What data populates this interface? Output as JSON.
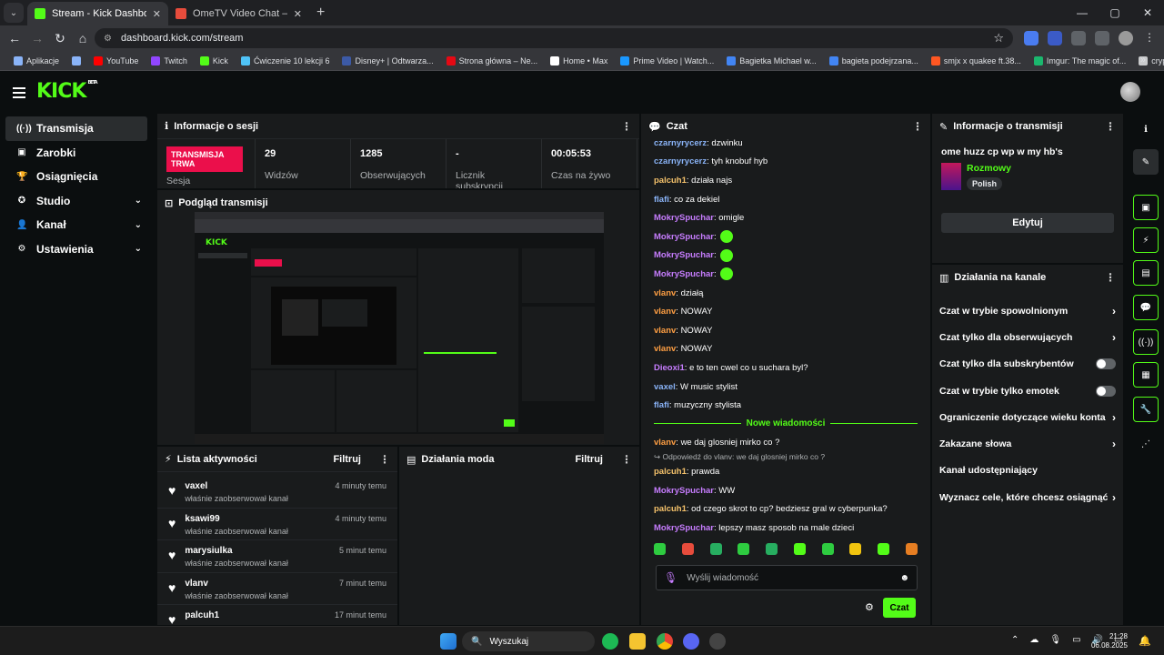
{
  "browser": {
    "tabs": [
      {
        "title": "Stream - Kick Dashboard",
        "color": "#53fc18",
        "active": true
      },
      {
        "title": "OmeTV Video Chat — Ome",
        "color": "#e74c3c",
        "active": false
      }
    ],
    "url": "dashboard.kick.com/stream",
    "bookmarks": [
      {
        "label": "Aplikacje",
        "color": "#8ab4f8"
      },
      {
        "label": "",
        "color": "#8ab4f8"
      },
      {
        "label": "YouTube",
        "color": "#ff0000"
      },
      {
        "label": "Twitch",
        "color": "#9146ff"
      },
      {
        "label": "Kick",
        "color": "#53fc18"
      },
      {
        "label": "Ćwiczenie 10 lekcji 6",
        "color": "#4fc3f7"
      },
      {
        "label": "Disney+ | Odtwarza...",
        "color": "#3c5aa6"
      },
      {
        "label": "Strona główna – Ne...",
        "color": "#e50914"
      },
      {
        "label": "Home • Max",
        "color": "#ffffff"
      },
      {
        "label": "Prime Video | Watch...",
        "color": "#1a98ff"
      },
      {
        "label": "Bagietka Michael w...",
        "color": "#4285f4"
      },
      {
        "label": "bagieta podejrzana...",
        "color": "#4285f4"
      },
      {
        "label": "smjx x quakee ft.38...",
        "color": "#ff5722"
      },
      {
        "label": "Imgur: The magic of...",
        "color": "#1bb76e"
      },
      {
        "label": "crypto",
        "color": "#c9cacc"
      }
    ],
    "bookmarks_more": "»"
  },
  "sidebar": {
    "items": [
      {
        "label": "Transmisja",
        "icon": "((·))",
        "chev": ""
      },
      {
        "label": "Zarobki",
        "icon": "▣",
        "chev": ""
      },
      {
        "label": "Osiągnięcia",
        "icon": "🏆",
        "chev": ""
      },
      {
        "label": "Studio",
        "icon": "✪",
        "chev": "⌄"
      },
      {
        "label": "Kanał",
        "icon": "👤",
        "chev": "⌄"
      },
      {
        "label": "Ustawienia",
        "icon": "⚙",
        "chev": "⌄"
      }
    ]
  },
  "session": {
    "title": "Informacje o sesji",
    "badge": "TRANSMISJA TRWA",
    "badge_sub": "Sesja",
    "stats": [
      {
        "value": "29",
        "label": "Widzów"
      },
      {
        "value": "1285",
        "label": "Obserwujących"
      },
      {
        "value": "-",
        "label": "Licznik subskrypcji"
      },
      {
        "value": "00:05:53",
        "label": "Czas na żywo"
      }
    ]
  },
  "preview": {
    "title": "Podgląd transmisji"
  },
  "activity": {
    "title": "Lista aktywności",
    "filter": "Filtruj",
    "items": [
      {
        "name": "vaxel",
        "desc": "właśnie zaobserwował kanał",
        "time": "4 minuty temu"
      },
      {
        "name": "ksawi99",
        "desc": "właśnie zaobserwował kanał",
        "time": "4 minuty temu"
      },
      {
        "name": "marysiulka",
        "desc": "właśnie zaobserwował kanał",
        "time": "5 minut temu"
      },
      {
        "name": "vlanv",
        "desc": "właśnie zaobserwował kanał",
        "time": "7 minut temu"
      },
      {
        "name": "palcuh1",
        "desc": "",
        "time": "17 minut temu"
      }
    ]
  },
  "mod": {
    "title": "Działania moda",
    "filter": "Filtruj"
  },
  "chat": {
    "title": "Czat",
    "messages": [
      {
        "user": "czarnyrycerz",
        "color": "#8ab4f8",
        "text": ": dzwinku"
      },
      {
        "user": "czarnyrycerz",
        "color": "#8ab4f8",
        "text": ": tyh knobuf hyb"
      },
      {
        "user": "palcuh1",
        "color": "#f5c26b",
        "text": ": działa najs"
      },
      {
        "user": "flafi",
        "color": "#8ab4f8",
        "text": ": co za dekiel"
      },
      {
        "user": "MokrySpuchar",
        "color": "#c77dff",
        "text": ": omigle"
      },
      {
        "user": "MokrySpuchar",
        "color": "#c77dff",
        "text": ":",
        "emote": true
      },
      {
        "user": "MokrySpuchar",
        "color": "#c77dff",
        "text": ":",
        "emote": true
      },
      {
        "user": "MokrySpuchar",
        "color": "#c77dff",
        "text": ":",
        "emote": true
      },
      {
        "user": "vlanv",
        "color": "#ff9f43",
        "text": ": działą"
      },
      {
        "user": "vlanv",
        "color": "#ff9f43",
        "text": ": NOWAY"
      },
      {
        "user": "vlanv",
        "color": "#ff9f43",
        "text": ": NOWAY"
      },
      {
        "user": "vlanv",
        "color": "#ff9f43",
        "text": ": NOWAY"
      },
      {
        "user": "Dieoxi1",
        "color": "#c77dff",
        "text": ": e to ten cwel co u suchara byl?"
      },
      {
        "user": "vaxel",
        "color": "#8ab4f8",
        "text": ": W music stylist"
      },
      {
        "user": "flafi",
        "color": "#8ab4f8",
        "text": ": muzyczny stylista"
      }
    ],
    "new_label": "Nowe wiadomości",
    "messages_after": [
      {
        "user": "vlanv",
        "color": "#ff9f43",
        "text": ": we daj glosniej mirko co ?"
      }
    ],
    "reply_hint": "↪ Odpowiedź do vlanv: we daj glosniej mirko co ?",
    "messages_last": [
      {
        "user": "palcuh1",
        "color": "#f5c26b",
        "text": ": prawda"
      },
      {
        "user": "MokrySpuchar",
        "color": "#c77dff",
        "text": ": WW"
      },
      {
        "user": "palcuh1",
        "color": "#f5c26b",
        "text": ": od czego skrot to cp? bedziesz gral w cyberpunka?"
      },
      {
        "user": "MokrySpuchar",
        "color": "#c77dff",
        "text": ": lepszy masz sposob na male dzieci"
      }
    ],
    "input_placeholder": "Wyślij wiadomość",
    "send_label": "Czat"
  },
  "streaminfo": {
    "title": "Informacje o transmisji",
    "stream_title": "ome huzz cp wp w my hb's",
    "category": "Rozmowy",
    "tag": "Polish",
    "edit_label": "Edytuj"
  },
  "channel_actions": {
    "title": "Działania na kanale",
    "items": [
      {
        "label": "Czat w trybie spowolnionym",
        "kind": "chev"
      },
      {
        "label": "Czat tylko dla obserwujących",
        "kind": "chev"
      },
      {
        "label": "Czat tylko dla subskrybentów",
        "kind": "toggle"
      },
      {
        "label": "Czat w trybie tylko emotek",
        "kind": "toggle"
      },
      {
        "label": "Ograniczenie dotyczące wieku konta",
        "kind": "chev"
      },
      {
        "label": "Zakazane słowa",
        "kind": "chev"
      },
      {
        "label": "Kanał udostępniający",
        "kind": "none"
      },
      {
        "label": "Wyznacz cele, które chcesz osiągnąć",
        "kind": "chev"
      }
    ]
  },
  "taskbar": {
    "search": "Wyszukaj",
    "time": "21:28",
    "date": "06.08.2025"
  }
}
